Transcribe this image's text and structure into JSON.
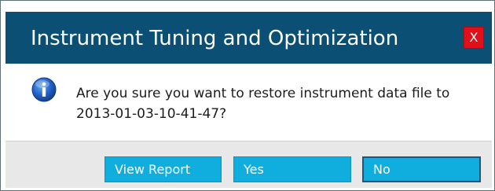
{
  "dialog": {
    "title": "Instrument Tuning and Optimization",
    "close_label": "X",
    "message_line1": "Are you sure you want to restore instrument data file to",
    "message_line2": "2013-01-03-10-41-47?",
    "icon": "info-icon",
    "buttons": {
      "view_report": "View Report",
      "yes": "Yes",
      "no": "No"
    }
  },
  "colors": {
    "title_bar": "#0c4f74",
    "close_button": "#e0101a",
    "button": "#10aede",
    "button_area": "#e8e8e8"
  }
}
